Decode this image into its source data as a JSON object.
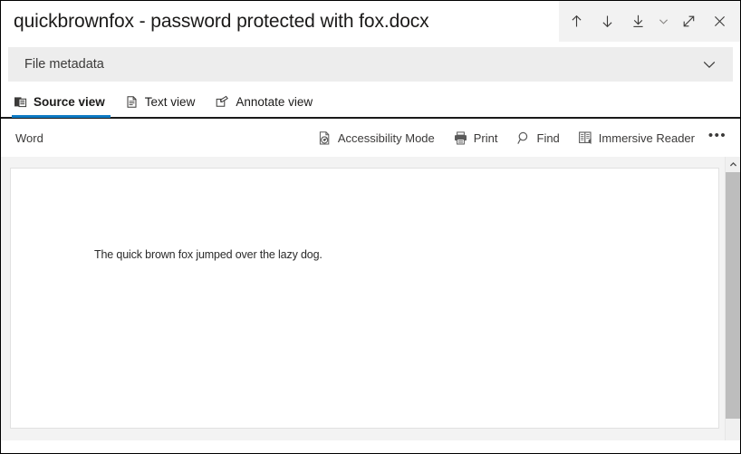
{
  "window": {
    "title": "quickbrownfox - password protected with fox.docx",
    "actions": [
      {
        "name": "previous-item-button",
        "icon": "arrow-up-icon",
        "label": "Previous"
      },
      {
        "name": "next-item-button",
        "icon": "arrow-down-icon",
        "label": "Next"
      },
      {
        "name": "download-button",
        "icon": "download-icon",
        "label": "Download"
      },
      {
        "name": "download-options-button",
        "icon": "chevron-down-icon",
        "label": "Download options"
      },
      {
        "name": "expand-button",
        "icon": "expand-diagonal-icon",
        "label": "Expand"
      },
      {
        "name": "close-button",
        "icon": "close-icon",
        "label": "Close"
      }
    ]
  },
  "metadata": {
    "label": "File metadata",
    "expand_icon": "chevron-down-icon"
  },
  "tabs": [
    {
      "label": "Source view",
      "icon": "source-view-icon",
      "active": true
    },
    {
      "label": "Text view",
      "icon": "text-view-icon",
      "active": false
    },
    {
      "label": "Annotate view",
      "icon": "annotate-view-icon",
      "active": false
    }
  ],
  "viewer": {
    "app_name": "Word",
    "tools": [
      {
        "label": "Accessibility Mode",
        "icon": "accessibility-icon"
      },
      {
        "label": "Print",
        "icon": "printer-icon"
      },
      {
        "label": "Find",
        "icon": "search-icon"
      },
      {
        "label": "Immersive Reader",
        "icon": "immersive-reader-icon"
      }
    ],
    "more_label": "•••"
  },
  "document": {
    "body_text": "The quick brown fox jumped over the lazy dog."
  },
  "scrollbar": {
    "up_arrow_icon": "scroll-up-icon"
  },
  "colors": {
    "accent": "#0d7ac4",
    "metadata_bar": "#ededed",
    "toolbar_bg": "#f2f2f2",
    "canvas_bg": "#f3f3f3",
    "scroll_thumb": "#bdbdbd"
  }
}
